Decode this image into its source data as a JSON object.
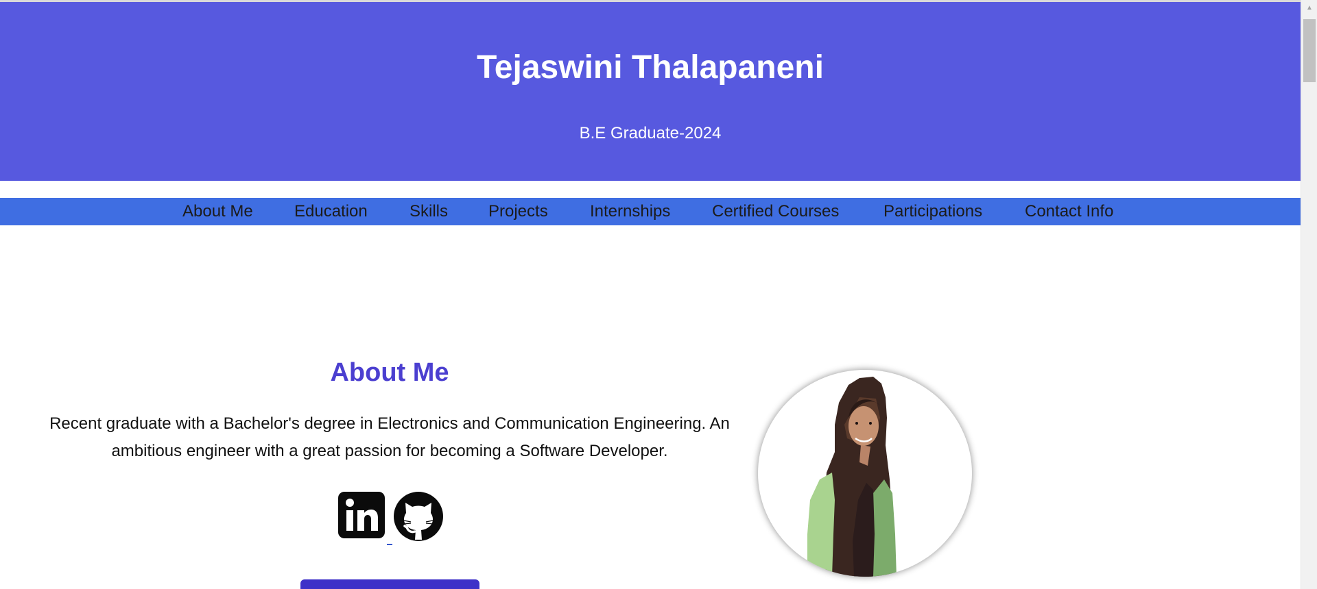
{
  "header": {
    "name": "Tejaswini Thalapaneni",
    "subtitle": "B.E Graduate-2024"
  },
  "nav": {
    "items": [
      "About Me",
      "Education",
      "Skills",
      "Projects",
      "Internships",
      "Certified Courses",
      "Participations",
      "Contact Info"
    ]
  },
  "about": {
    "title": "About Me",
    "text": "Recent graduate with a Bachelor's degree in Electronics and Communication Engineering. An ambitious engineer with a great passion for becoming a Software Developer."
  },
  "socials": {
    "items": [
      {
        "icon": "linkedin-icon"
      },
      {
        "icon": "github-icon"
      }
    ]
  },
  "colors": {
    "hero_bg": "#5759df",
    "nav_bg": "#3f6ee2",
    "accent": "#4b3fd0",
    "button": "#3e31c8"
  }
}
